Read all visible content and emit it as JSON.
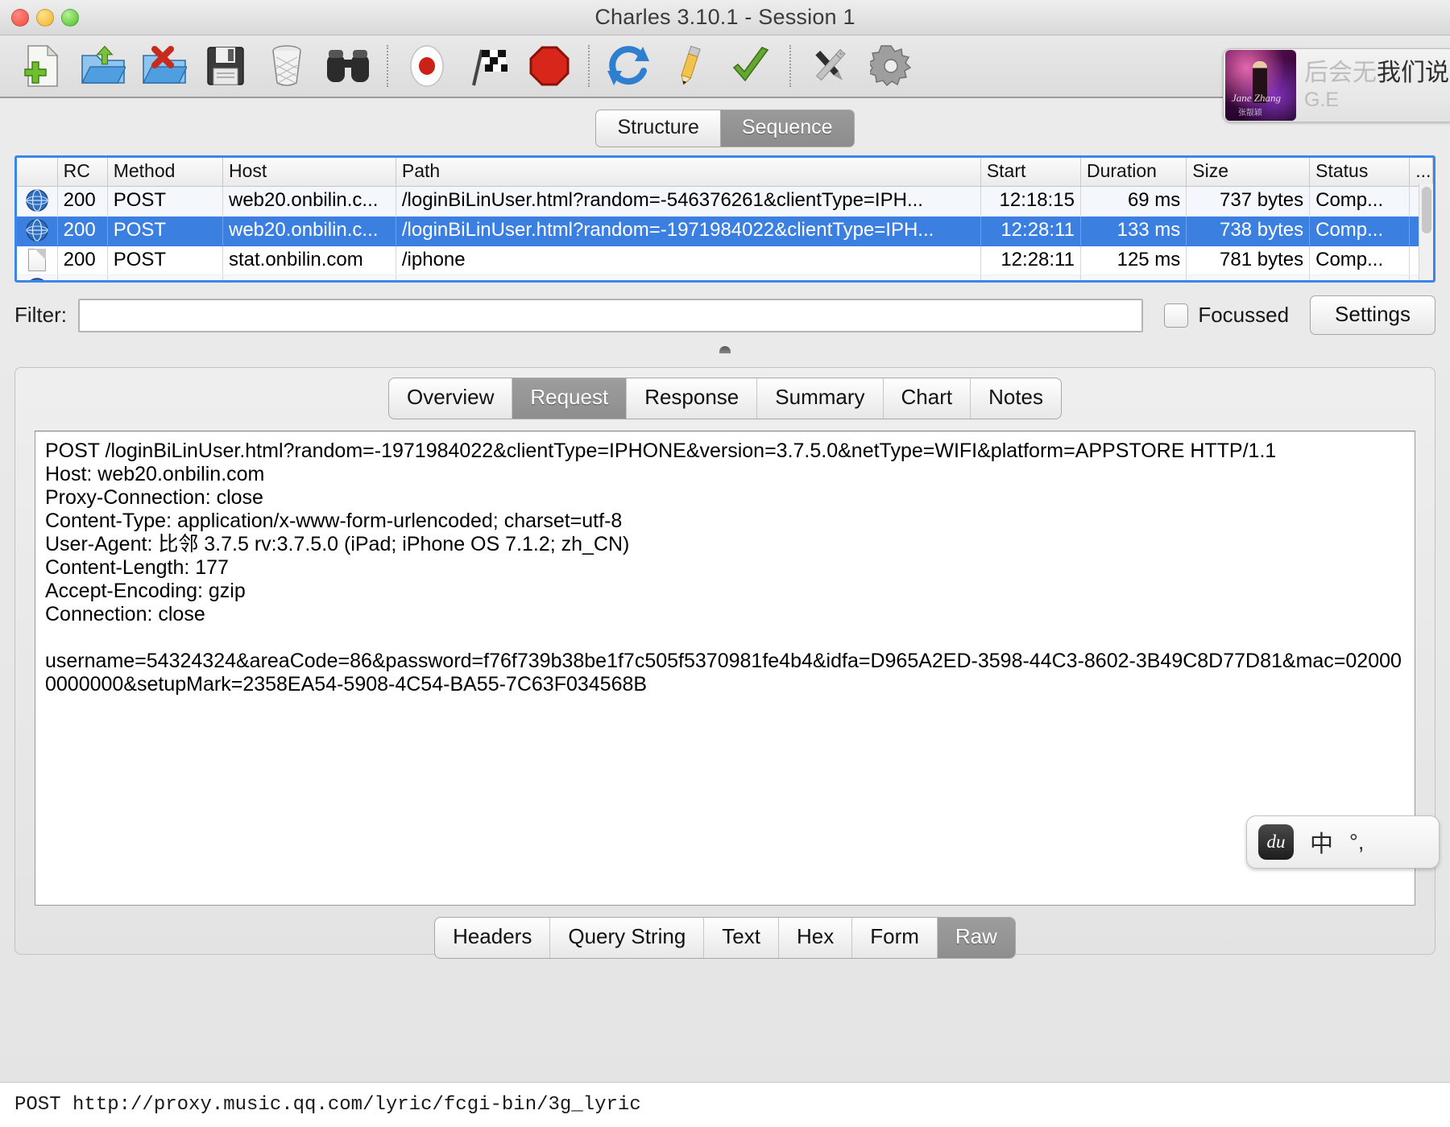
{
  "window": {
    "title": "Charles 3.10.1 - Session 1",
    "traffic_lights": [
      "close-red",
      "minimize-yellow",
      "zoom-green"
    ]
  },
  "toolbar": {
    "items": [
      {
        "name": "new-session-icon",
        "label": "New Session"
      },
      {
        "name": "open-session-icon",
        "label": "Open"
      },
      {
        "name": "close-session-icon",
        "label": "Close"
      },
      {
        "name": "save-session-icon",
        "label": "Save"
      },
      {
        "name": "clear-session-icon",
        "label": "Clear"
      },
      {
        "name": "find-icon",
        "label": "Find"
      },
      {
        "name": "record-icon",
        "label": "Record"
      },
      {
        "name": "throttle-icon",
        "label": "Throttle"
      },
      {
        "name": "breakpoints-icon",
        "label": "Breakpoints"
      },
      {
        "name": "repeat-icon",
        "label": "Repeat"
      },
      {
        "name": "compose-icon",
        "label": "Compose"
      },
      {
        "name": "validate-icon",
        "label": "Validate"
      },
      {
        "name": "tools-icon",
        "label": "Tools"
      },
      {
        "name": "settings-gear-icon",
        "label": "Settings"
      }
    ]
  },
  "music_widget": {
    "title_ghost": "后会无",
    "title": "我们说",
    "artist": "G.E"
  },
  "view_tabs": {
    "items": [
      {
        "label": "Structure",
        "active": false
      },
      {
        "label": "Sequence",
        "active": true
      }
    ]
  },
  "sessions": {
    "columns": [
      "",
      "RC",
      "Method",
      "Host",
      "Path",
      "Start",
      "Duration",
      "Size",
      "Status",
      "..."
    ],
    "rows": [
      {
        "icon": "globe-icon",
        "rc": "200",
        "method": "POST",
        "host": "web20.onbilin.c...",
        "path": "/loginBiLinUser.html?random=-546376261&clientType=IPH...",
        "start": "12:18:15",
        "duration": "69 ms",
        "size": "737 bytes",
        "status": "Comp...",
        "selected": false
      },
      {
        "icon": "globe-icon",
        "rc": "200",
        "method": "POST",
        "host": "web20.onbilin.c...",
        "path": "/loginBiLinUser.html?random=-1971984022&clientType=IPH...",
        "start": "12:28:11",
        "duration": "133 ms",
        "size": "738 bytes",
        "status": "Comp...",
        "selected": true
      },
      {
        "icon": "document-icon",
        "rc": "200",
        "method": "POST",
        "host": "stat.onbilin.com",
        "path": "/iphone",
        "start": "12:28:11",
        "duration": "125 ms",
        "size": "781 bytes",
        "status": "Comp...",
        "selected": false
      }
    ]
  },
  "filter": {
    "label": "Filter:",
    "value": "",
    "placeholder": "",
    "focussed_label": "Focussed",
    "focussed_checked": false,
    "settings_label": "Settings"
  },
  "detail_tabs": {
    "items": [
      {
        "label": "Overview",
        "active": false
      },
      {
        "label": "Request",
        "active": true
      },
      {
        "label": "Response",
        "active": false
      },
      {
        "label": "Summary",
        "active": false
      },
      {
        "label": "Chart",
        "active": false
      },
      {
        "label": "Notes",
        "active": false
      }
    ]
  },
  "raw_view": {
    "content": "POST /loginBiLinUser.html?random=-1971984022&clientType=IPHONE&version=3.7.5.0&netType=WIFI&platform=APPSTORE HTTP/1.1\nHost: web20.onbilin.com\nProxy-Connection: close\nContent-Type: application/x-www-form-urlencoded; charset=utf-8\nUser-Agent: 比邻 3.7.5 rv:3.7.5.0 (iPad; iPhone OS 7.1.2; zh_CN)\nContent-Length: 177\nAccept-Encoding: gzip\nConnection: close\n\nusername=54324324&areaCode=86&password=f76f739b38be1f7c505f5370981fe4b4&idfa=D965A2ED-3598-44C3-8602-3B49C8D77D81&mac=020000000000&setupMark=2358EA54-5908-4C54-BA55-7C63F034568B"
  },
  "format_tabs": {
    "items": [
      {
        "label": "Headers",
        "active": false
      },
      {
        "label": "Query String",
        "active": false
      },
      {
        "label": "Text",
        "active": false
      },
      {
        "label": "Hex",
        "active": false
      },
      {
        "label": "Form",
        "active": false
      },
      {
        "label": "Raw",
        "active": true
      }
    ]
  },
  "ime": {
    "badge": "du",
    "language": "中",
    "punctuation": "°,"
  },
  "statusbar": {
    "text": "POST http://proxy.music.qq.com/lyric/fcgi-bin/3g_lyric"
  }
}
